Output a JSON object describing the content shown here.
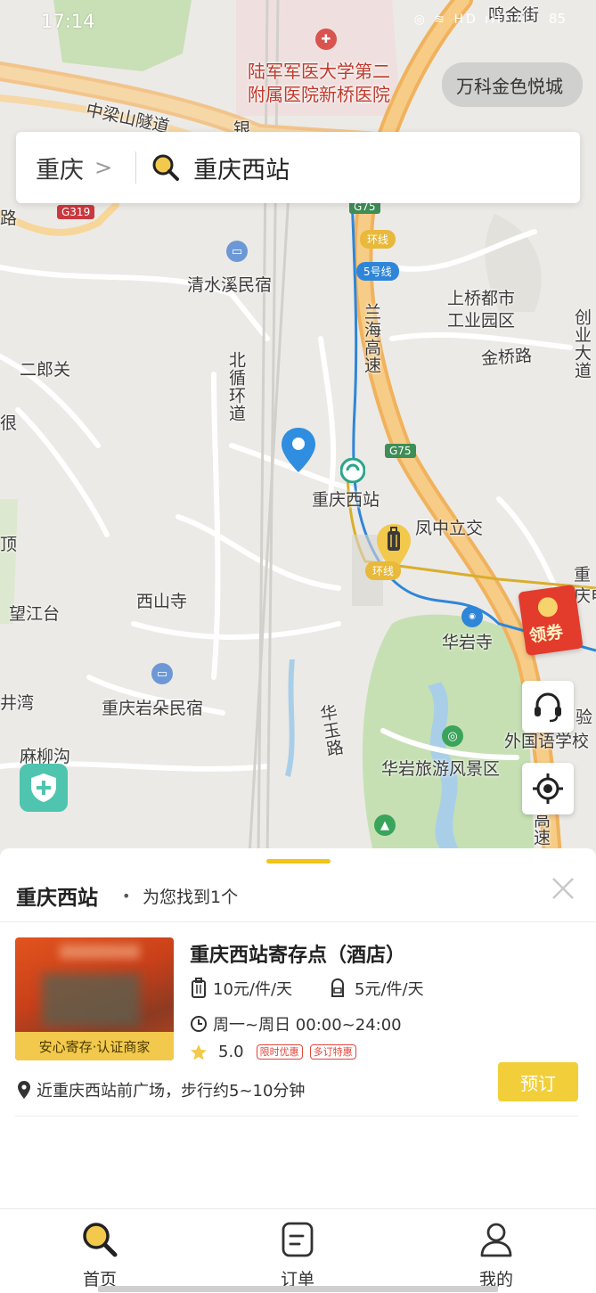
{
  "status_bar": {
    "time": "17:14",
    "icons": "◎ ≋ HD ıll ıll",
    "battery": "85"
  },
  "map": {
    "hospital_label_line1": "陆军军医大学第二",
    "hospital_label_line2": "附属医院新桥医院",
    "landmark_chip": "万科金色悦城",
    "labels": {
      "mingjin_street": "鸣金街",
      "zhongliangshan_tunnel": "中梁山隧道",
      "road_fragment_left": "路",
      "road_fragment_yin": "银",
      "qingshuixi": "清水溪民宿",
      "shangqiao_1": "上桥都市",
      "shangqiao_2": "工业园区",
      "lanhai": "兰海高速",
      "jinqiao": "金桥路",
      "chuangye": "创业大道",
      "erlangguan": "二郎关",
      "beixun": "北循环道",
      "chongqing_west": "重庆西站",
      "fengzhong": "凤中立交",
      "ding": "顶",
      "wangjiangtai": "望江台",
      "xishansi": "西山寺",
      "huayansi": "华岩寺",
      "jingwan": "井湾",
      "yanduo": "重庆岩朵民宿",
      "huayulu": "华玉路",
      "waiguoyu": "外国语学校",
      "yan": "验",
      "maliugou": "麻柳沟",
      "huayan_scenic": "华岩旅游风景区",
      "chong_right": "重",
      "chongdian": "庆电",
      "gaosu": "高速",
      "hen": "很"
    },
    "badges": {
      "g319": "G319",
      "g75_top": "G75",
      "g75_mid": "G75",
      "ring_top": "环线",
      "ring_mid": "环线",
      "line5": "5号线"
    },
    "coupon_label": "领券"
  },
  "search": {
    "city": "重庆",
    "query": "重庆西站"
  },
  "sheet": {
    "title": "重庆西站",
    "dot": "•",
    "count_text": "为您找到1个"
  },
  "result": {
    "name": "重庆西站寄存点（酒店）",
    "photo_badge": "安心寄存·认证商家",
    "price_large": "10元/件/天",
    "price_small": "5元/件/天",
    "hours": "周一~周日 00:00~24:00",
    "rating": "5.0",
    "tags": [
      "限时优惠",
      "多订特惠"
    ],
    "location": "近重庆西站前广场，步行约5~10分钟",
    "book_label": "预订"
  },
  "tabs": [
    {
      "label": "首页",
      "icon": "search-icon"
    },
    {
      "label": "订单",
      "icon": "order-icon"
    },
    {
      "label": "我的",
      "icon": "user-icon"
    }
  ],
  "colors": {
    "accent": "#f2c94c",
    "book_button": "#f2cf3a",
    "promo": "#e2463c",
    "map_bg": "#eceae6"
  }
}
